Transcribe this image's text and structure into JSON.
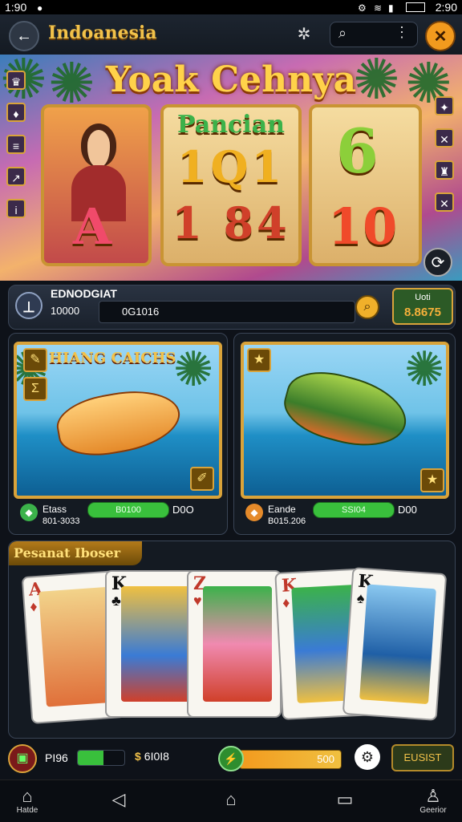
{
  "status": {
    "time_left": "1:90",
    "time_right": "2:90"
  },
  "header": {
    "title": "Indoanesia"
  },
  "banner": {
    "title": "Yoak Cehnya",
    "reel1_symbol": "A",
    "reel2_title": "Pancian",
    "reel2_row1": "1Q1",
    "reel2_row2": "1 84",
    "reel3_top": "6",
    "reel3_bottom": "10"
  },
  "player": {
    "name": "EDNODGIAT",
    "value": "10000",
    "balance": "0G1016",
    "win_label": "Uoti",
    "win_value": "8.8675"
  },
  "games": [
    {
      "title": "HIANG CAICHS",
      "name": "Etass",
      "bar": "B0100",
      "count": "D0O",
      "sub": "801-3033"
    },
    {
      "title": "",
      "name": "Eande",
      "bar": "SSI04",
      "count": "D00",
      "sub": "B015.206"
    }
  ],
  "cards": {
    "title": "Pesanat Iboser",
    "items": [
      {
        "rank": "A",
        "suit": "♦",
        "color": "#c0392b"
      },
      {
        "rank": "K",
        "suit": "♣",
        "color": "#111111"
      },
      {
        "rank": "Z",
        "suit": "♥",
        "color": "#c0392b"
      },
      {
        "rank": "K",
        "suit": "♦",
        "color": "#c0392b"
      },
      {
        "rank": "K",
        "suit": "♠",
        "color": "#111111"
      }
    ]
  },
  "bottom": {
    "level": "PI96",
    "level_fill": 0.55,
    "coins": "6I0I8",
    "energy": "500",
    "spin_label": "EUSIST"
  },
  "nav": {
    "home": "Hatde",
    "profile": "Geerior"
  }
}
